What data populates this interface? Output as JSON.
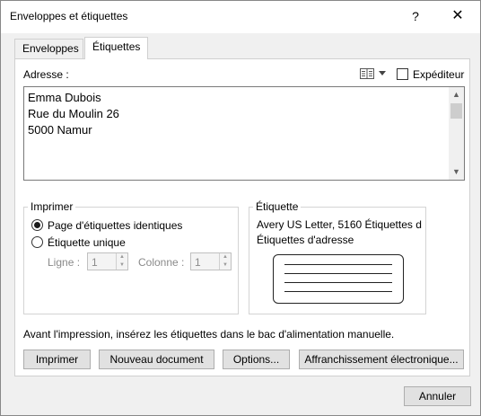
{
  "window": {
    "title": "Enveloppes et étiquettes",
    "help_label": "?",
    "close_label": "✕"
  },
  "tabs": [
    {
      "label": "Enveloppes",
      "selected": false
    },
    {
      "label": "Étiquettes",
      "selected": true
    }
  ],
  "address": {
    "label": "Adresse :",
    "lines": [
      "Emma Dubois",
      "Rue du Moulin 26",
      "5000 Namur"
    ],
    "sender_checkbox_label": "Expéditeur",
    "sender_checked": false,
    "address_book_icon": "address-book-icon"
  },
  "print_group": {
    "title": "Imprimer",
    "options": [
      {
        "label": "Page d'étiquettes identiques",
        "selected": true
      },
      {
        "label": "Étiquette unique",
        "selected": false
      }
    ],
    "row_label": "Ligne :",
    "row_value": "1",
    "column_label": "Colonne :",
    "column_value": "1"
  },
  "label_group": {
    "title": "Étiquette",
    "product": "Avery US Letter, 5160 Étiquettes d...",
    "type": "Étiquettes d'adresse"
  },
  "note": "Avant l'impression, insérez les étiquettes dans le bac d'alimentation manuelle.",
  "buttons": {
    "print": "Imprimer",
    "new_document": "Nouveau document",
    "options": "Options...",
    "franking": "Affranchissement électronique...",
    "cancel": "Annuler"
  }
}
